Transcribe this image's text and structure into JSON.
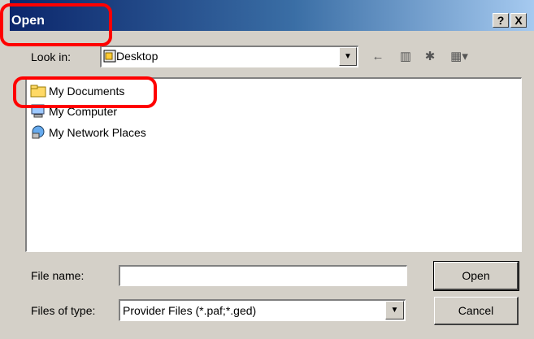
{
  "window": {
    "title": "Open",
    "help_button": "?",
    "close_button": "X"
  },
  "lookin": {
    "label": "Look in:",
    "value": "Desktop",
    "folder_icon": "desktop-folder-icon"
  },
  "toolbar": {
    "back_icon": "back-arrow-icon",
    "up_icon": "up-folder-icon",
    "new_folder_icon": "new-folder-icon",
    "view_icon": "view-menu-icon"
  },
  "files": [
    {
      "label": "My Documents",
      "icon": "documents-folder-icon"
    },
    {
      "label": "My Computer",
      "icon": "computer-icon"
    },
    {
      "label": "My Network Places",
      "icon": "network-places-icon"
    }
  ],
  "filename": {
    "label": "File name:",
    "value": ""
  },
  "filetype": {
    "label": "Files of type:",
    "value": "Provider Files (*.paf;*.ged)"
  },
  "buttons": {
    "open": "Open",
    "cancel": "Cancel"
  },
  "colors": {
    "title_start": "#0a246a",
    "title_end": "#a6caf0",
    "highlight": "#ff0000",
    "dialog_bg": "#d4d0c8"
  }
}
